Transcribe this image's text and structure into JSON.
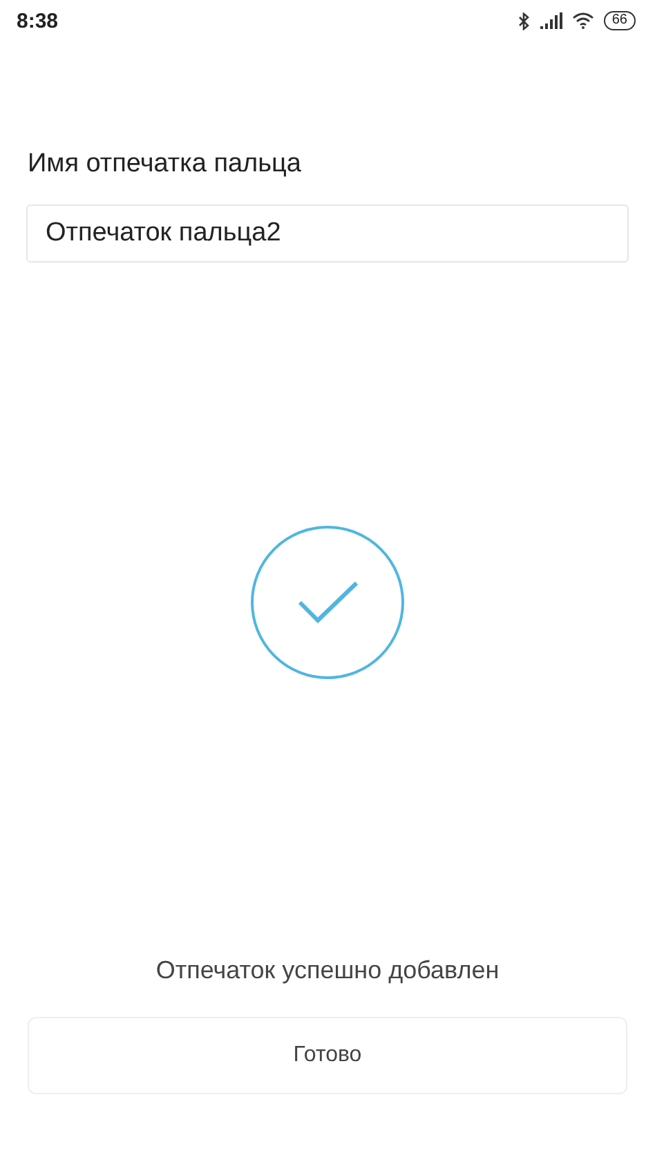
{
  "status_bar": {
    "time": "8:38",
    "battery": "66"
  },
  "name_label": "Имя отпечатка пальца",
  "name_field": {
    "value": "Отпечаток пальца2"
  },
  "message": "Отпечаток успешно добавлен",
  "done_button": {
    "label": "Готово"
  }
}
